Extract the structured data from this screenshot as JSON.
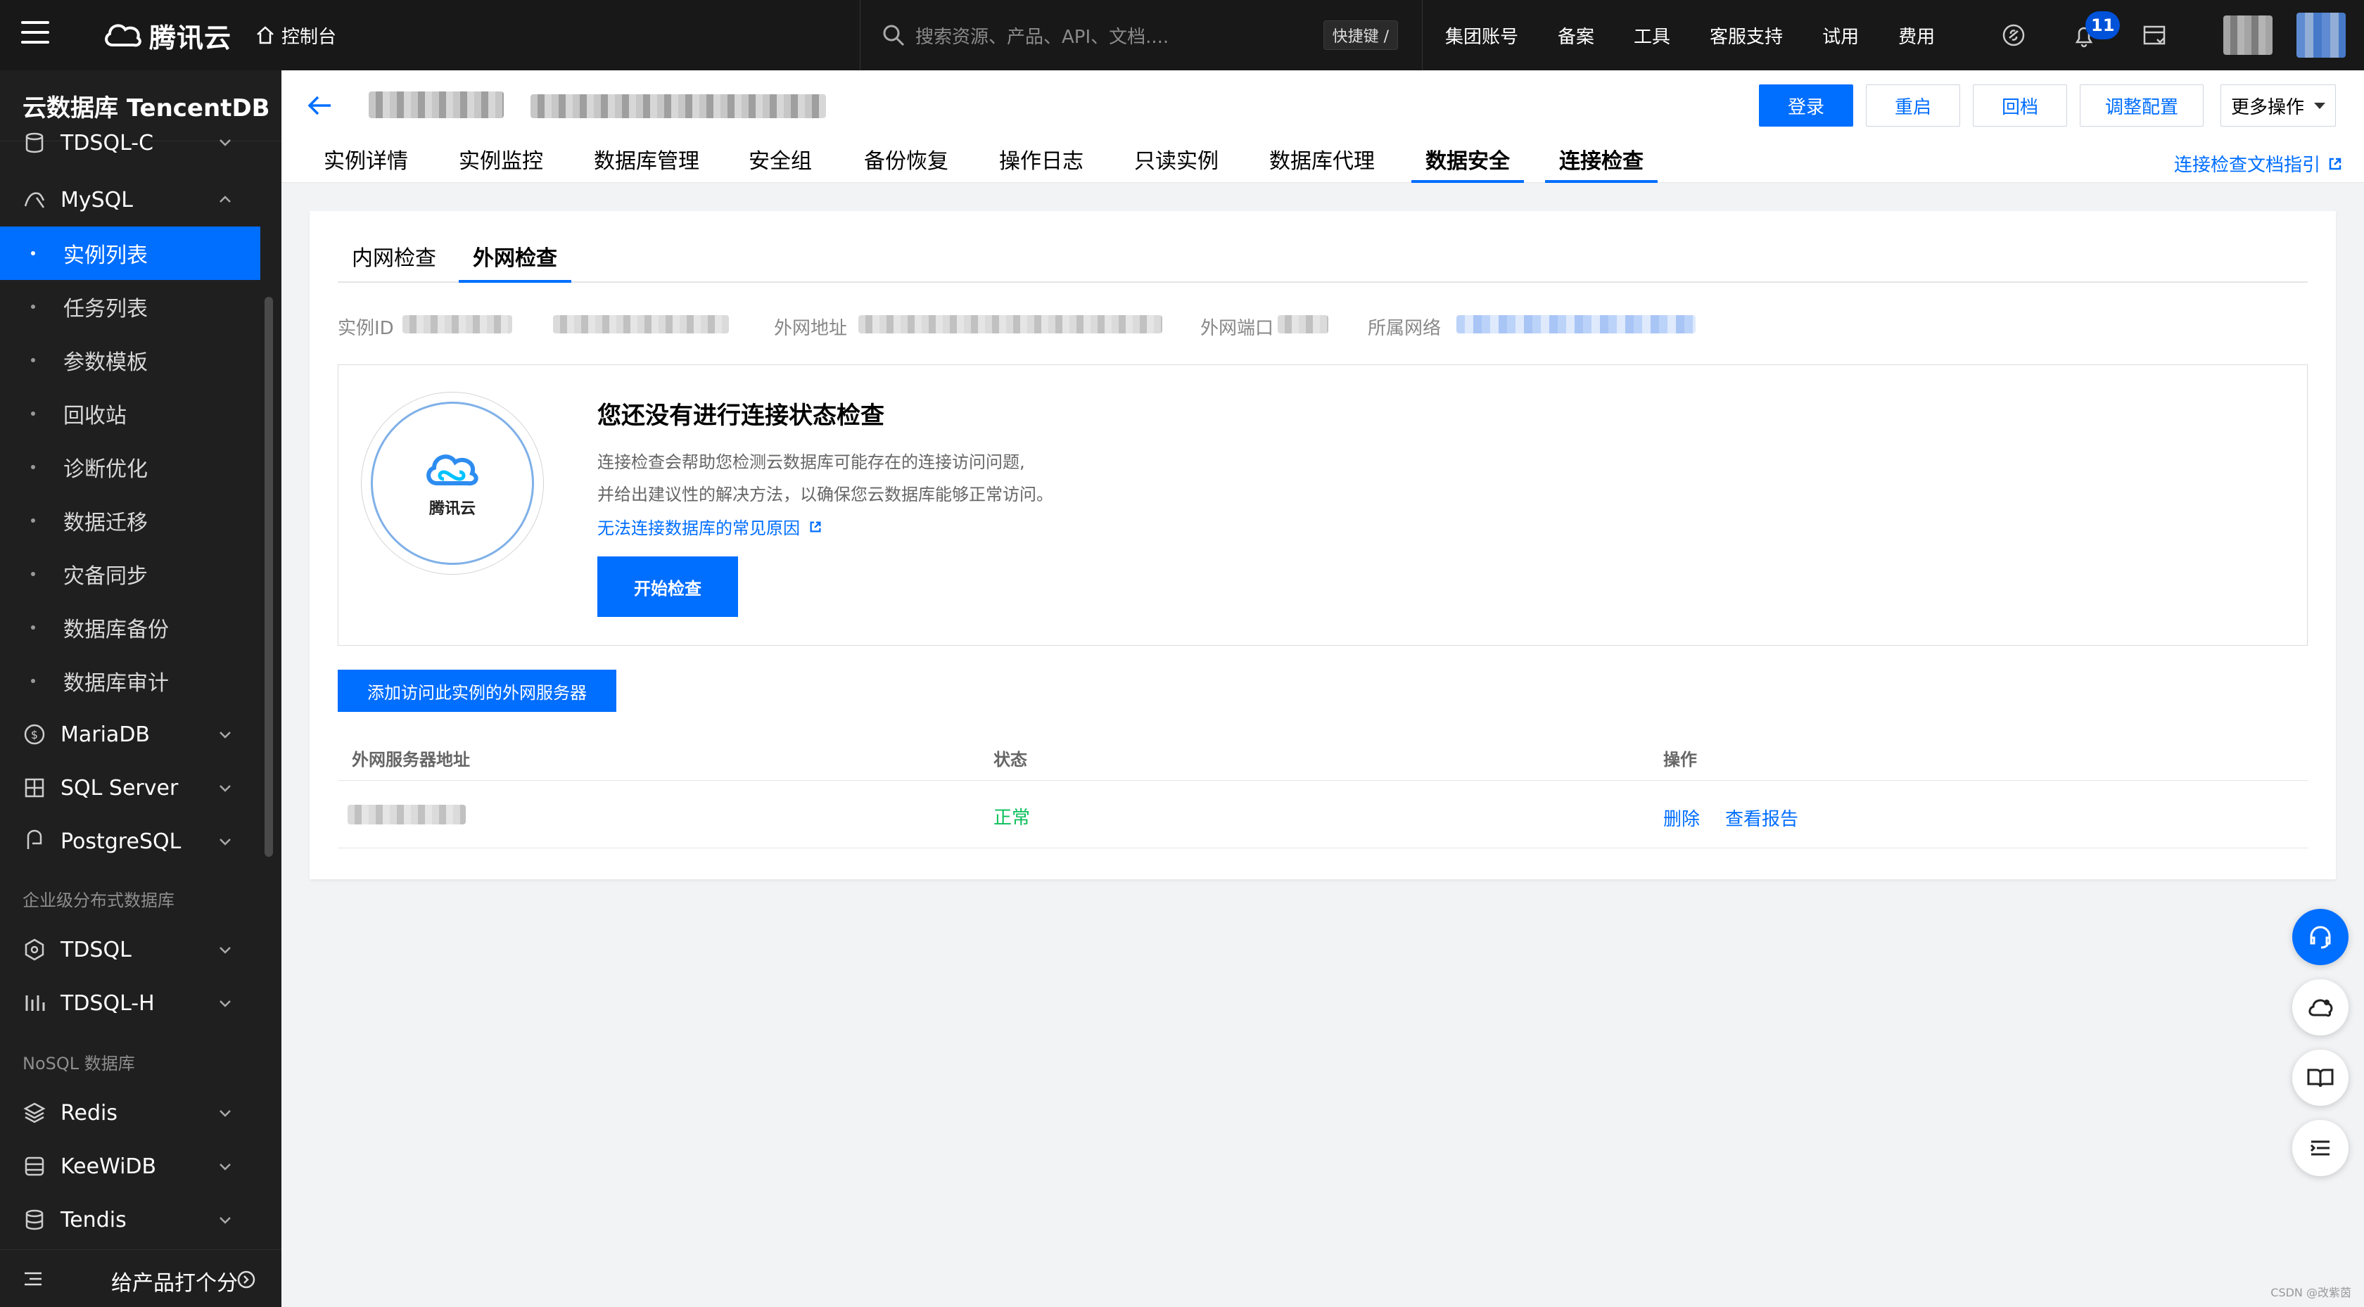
{
  "topnav": {
    "logo_text": "腾讯云",
    "console": "控制台",
    "search_placeholder": "搜索资源、产品、API、文档....",
    "shortcut": "快捷键 /",
    "links": [
      "集团账号",
      "备案",
      "工具",
      "客服支持",
      "试用",
      "费用"
    ],
    "notification_count": "11"
  },
  "sidebar": {
    "title": "云数据库 TencentDB",
    "top_cut": "TDSQL-C",
    "mysql": "MySQL",
    "mysql_items": [
      "实例列表",
      "任务列表",
      "参数模板",
      "回收站",
      "诊断优化",
      "数据迁移",
      "灾备同步",
      "数据库备份",
      "数据库审计"
    ],
    "groups": [
      "MariaDB",
      "SQL Server",
      "PostgreSQL"
    ],
    "section_enterprise": "企业级分布式数据库",
    "enterprise_groups": [
      "TDSQL",
      "TDSQL-H"
    ],
    "section_nosql": "NoSQL 数据库",
    "nosql_groups": [
      "Redis",
      "KeeWiDB",
      "Tendis"
    ],
    "footer_rate": "给产品打个分"
  },
  "header": {
    "buttons": [
      "登录",
      "重启",
      "回档",
      "调整配置",
      "更多操作"
    ],
    "tabs": [
      "实例详情",
      "实例监控",
      "数据库管理",
      "安全组",
      "备份恢复",
      "操作日志",
      "只读实例",
      "数据库代理",
      "数据安全",
      "连接检查"
    ],
    "doc_link": "连接检查文档指引"
  },
  "card": {
    "inner_tabs": [
      "内网检查",
      "外网检查"
    ],
    "info_labels": [
      "实例ID",
      "外网地址",
      "外网端口",
      "所属网络"
    ],
    "cloud_text": "腾讯云",
    "check_title": "您还没有进行连接状态检查",
    "check_desc1": "连接检查会帮助您检测云数据库可能存在的连接访问问题,",
    "check_desc2": "并给出建议性的解决方法，以确保您云数据库能够正常访问。",
    "check_link": "无法连接数据库的常见原因",
    "start_button": "开始检查",
    "add_button": "添加访问此实例的外网服务器",
    "table": {
      "headers": [
        "外网服务器地址",
        "状态",
        "操作"
      ],
      "rows": [
        {
          "status": "正常",
          "ops": [
            "删除",
            "查看报告"
          ]
        }
      ]
    }
  },
  "watermark": "CSDN @改紫茵"
}
